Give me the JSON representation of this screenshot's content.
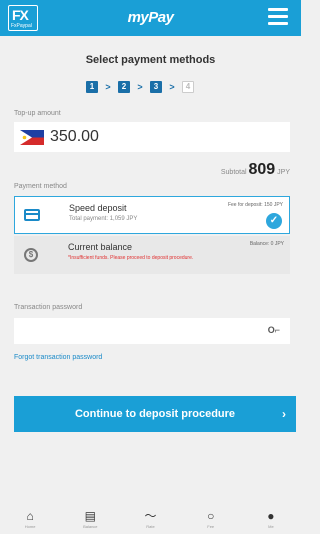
{
  "header": {
    "logo": "FX",
    "logo_sub": "FxPaypal",
    "app_title": "myPay",
    "menu_icon": "hamburger-menu-icon"
  },
  "page": {
    "title": "Select payment methods",
    "steps": [
      "1",
      "2",
      "3",
      "4"
    ],
    "active_steps": 3
  },
  "topup": {
    "label": "Top-up amount",
    "amount": "350.00",
    "flag": "philippines-flag-icon",
    "subtotal_label": "Subtotal",
    "subtotal_value": "809",
    "subtotal_unit": "JPY"
  },
  "payment": {
    "label": "Payment method",
    "methods": [
      {
        "title": "Speed deposit",
        "sub": "Total payment: 1,059 JPY",
        "right": "Fee for deposit: 150 JPY",
        "icon": "card-icon",
        "selected": true
      },
      {
        "title": "Current balance",
        "warning": "*Insufficient funds. Please proceed to deposit procedure.",
        "right": "Balance: 0 JPY",
        "icon": "wallet-icon",
        "selected": false
      }
    ]
  },
  "password": {
    "label": "Transaction password",
    "value": "",
    "key_icon": "key-icon",
    "forgot": "Forgot transaction password"
  },
  "continue_label": "Continue to deposit procedure",
  "nav": [
    {
      "label": "Home",
      "icon": "home-icon"
    },
    {
      "label": "Balance",
      "icon": "document-icon"
    },
    {
      "label": "Rate",
      "icon": "chart-icon"
    },
    {
      "label": "Fee",
      "icon": "refresh-icon"
    },
    {
      "label": "Me",
      "icon": "user-icon"
    }
  ],
  "colors": {
    "brand": "#1a9fd6",
    "step_active": "#1a6fa8",
    "warning": "#e03030"
  }
}
